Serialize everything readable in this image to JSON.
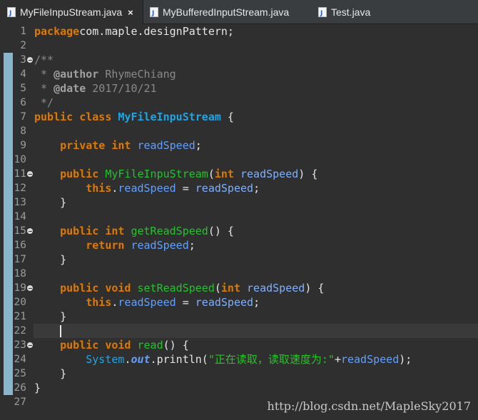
{
  "tabs": [
    {
      "label": "MyFileInpuStream.java",
      "active": true,
      "close_icon": "×"
    },
    {
      "label": "MyBufferedInputStream.java",
      "active": false
    },
    {
      "label": "Test.java",
      "active": false
    }
  ],
  "editor": {
    "lines": [
      {
        "n": "1",
        "fold": false,
        "tokens": [
          [
            "kw",
            "package"
          ],
          [
            "",
            "com.maple.designPattern;"
          ]
        ]
      },
      {
        "n": "2",
        "fold": false,
        "tokens": []
      },
      {
        "n": "3",
        "fold": true,
        "tokens": [
          [
            "cmt",
            "/**"
          ]
        ]
      },
      {
        "n": "4",
        "fold": false,
        "tokens": [
          [
            "cmt",
            " * "
          ],
          [
            "tag",
            "@author"
          ],
          [
            "cmt",
            " RhymeChiang"
          ]
        ]
      },
      {
        "n": "5",
        "fold": false,
        "tokens": [
          [
            "cmt",
            " * "
          ],
          [
            "tag",
            "@date"
          ],
          [
            "cmt",
            " 2017/10/21"
          ]
        ]
      },
      {
        "n": "6",
        "fold": false,
        "tokens": [
          [
            "cmt",
            " */"
          ]
        ]
      },
      {
        "n": "7",
        "fold": false,
        "tokens": [
          [
            "kw",
            "public"
          ],
          [
            "",
            " "
          ],
          [
            "kw",
            "class"
          ],
          [
            "",
            " "
          ],
          [
            "cls",
            "MyFileInpuStream"
          ],
          [
            "",
            " {"
          ]
        ]
      },
      {
        "n": "8",
        "fold": false,
        "tokens": []
      },
      {
        "n": "9",
        "fold": false,
        "tokens": [
          [
            "",
            "    "
          ],
          [
            "kw",
            "private"
          ],
          [
            "",
            " "
          ],
          [
            "kw",
            "int"
          ],
          [
            "",
            " "
          ],
          [
            "fld",
            "readSpeed"
          ],
          [
            "",
            ";"
          ]
        ]
      },
      {
        "n": "10",
        "fold": false,
        "tokens": []
      },
      {
        "n": "11",
        "fold": true,
        "tokens": [
          [
            "",
            "    "
          ],
          [
            "kw",
            "public"
          ],
          [
            "",
            " "
          ],
          [
            "mth",
            "MyFileInpuStream"
          ],
          [
            "",
            "("
          ],
          [
            "kw",
            "int"
          ],
          [
            "",
            " "
          ],
          [
            "par",
            "readSpeed"
          ],
          [
            "",
            ") {"
          ]
        ]
      },
      {
        "n": "12",
        "fold": false,
        "tokens": [
          [
            "",
            "        "
          ],
          [
            "kw",
            "this"
          ],
          [
            "",
            "."
          ],
          [
            "fld",
            "readSpeed"
          ],
          [
            "",
            " = "
          ],
          [
            "par",
            "readSpeed"
          ],
          [
            "",
            ";"
          ]
        ]
      },
      {
        "n": "13",
        "fold": false,
        "tokens": [
          [
            "",
            "    }"
          ]
        ]
      },
      {
        "n": "14",
        "fold": false,
        "tokens": []
      },
      {
        "n": "15",
        "fold": true,
        "tokens": [
          [
            "",
            "    "
          ],
          [
            "kw",
            "public"
          ],
          [
            "",
            " "
          ],
          [
            "kw",
            "int"
          ],
          [
            "",
            " "
          ],
          [
            "mth",
            "getReadSpeed"
          ],
          [
            "",
            "() {"
          ]
        ]
      },
      {
        "n": "16",
        "fold": false,
        "tokens": [
          [
            "",
            "        "
          ],
          [
            "kw",
            "return"
          ],
          [
            "",
            " "
          ],
          [
            "fld",
            "readSpeed"
          ],
          [
            "",
            ";"
          ]
        ]
      },
      {
        "n": "17",
        "fold": false,
        "tokens": [
          [
            "",
            "    }"
          ]
        ]
      },
      {
        "n": "18",
        "fold": false,
        "tokens": []
      },
      {
        "n": "19",
        "fold": true,
        "tokens": [
          [
            "",
            "    "
          ],
          [
            "kw",
            "public"
          ],
          [
            "",
            " "
          ],
          [
            "kw",
            "void"
          ],
          [
            "",
            " "
          ],
          [
            "mth",
            "setReadSpeed"
          ],
          [
            "",
            "("
          ],
          [
            "kw",
            "int"
          ],
          [
            "",
            " "
          ],
          [
            "par",
            "readSpeed"
          ],
          [
            "",
            ") {"
          ]
        ]
      },
      {
        "n": "20",
        "fold": false,
        "tokens": [
          [
            "",
            "        "
          ],
          [
            "kw",
            "this"
          ],
          [
            "",
            "."
          ],
          [
            "fld",
            "readSpeed"
          ],
          [
            "",
            " = "
          ],
          [
            "par",
            "readSpeed"
          ],
          [
            "",
            ";"
          ]
        ]
      },
      {
        "n": "21",
        "fold": false,
        "tokens": [
          [
            "",
            "    }"
          ]
        ]
      },
      {
        "n": "22",
        "fold": false,
        "tokens": []
      },
      {
        "n": "23",
        "fold": true,
        "tokens": [
          [
            "",
            "    "
          ],
          [
            "kw",
            "public"
          ],
          [
            "",
            " "
          ],
          [
            "kw",
            "void"
          ],
          [
            "",
            " "
          ],
          [
            "mth",
            "read"
          ],
          [
            "",
            "() {"
          ]
        ]
      },
      {
        "n": "24",
        "fold": false,
        "tokens": [
          [
            "",
            "        "
          ],
          [
            "sys",
            "System"
          ],
          [
            "",
            "."
          ],
          [
            "out",
            "out"
          ],
          [
            "",
            ".println("
          ],
          [
            "str",
            "\"正在读取，读取速度为:\""
          ],
          [
            "",
            "+"
          ],
          [
            "fld",
            "readSpeed"
          ],
          [
            "",
            ");"
          ]
        ]
      },
      {
        "n": "25",
        "fold": false,
        "tokens": [
          [
            "",
            "    }"
          ]
        ]
      },
      {
        "n": "26",
        "fold": false,
        "tokens": [
          [
            "",
            "}"
          ]
        ]
      },
      {
        "n": "27",
        "fold": false,
        "tokens": []
      }
    ]
  },
  "watermark": "http://blog.csdn.net/MapleSky2017",
  "colors": {
    "background": "#2f2f2f",
    "keyword": "#e07900",
    "class_name": "#1ea5e6",
    "method": "#22c42b",
    "field": "#60a0ff",
    "comment": "#8a8a8a",
    "string": "#27c227",
    "change_bar": "#88b6cc"
  }
}
